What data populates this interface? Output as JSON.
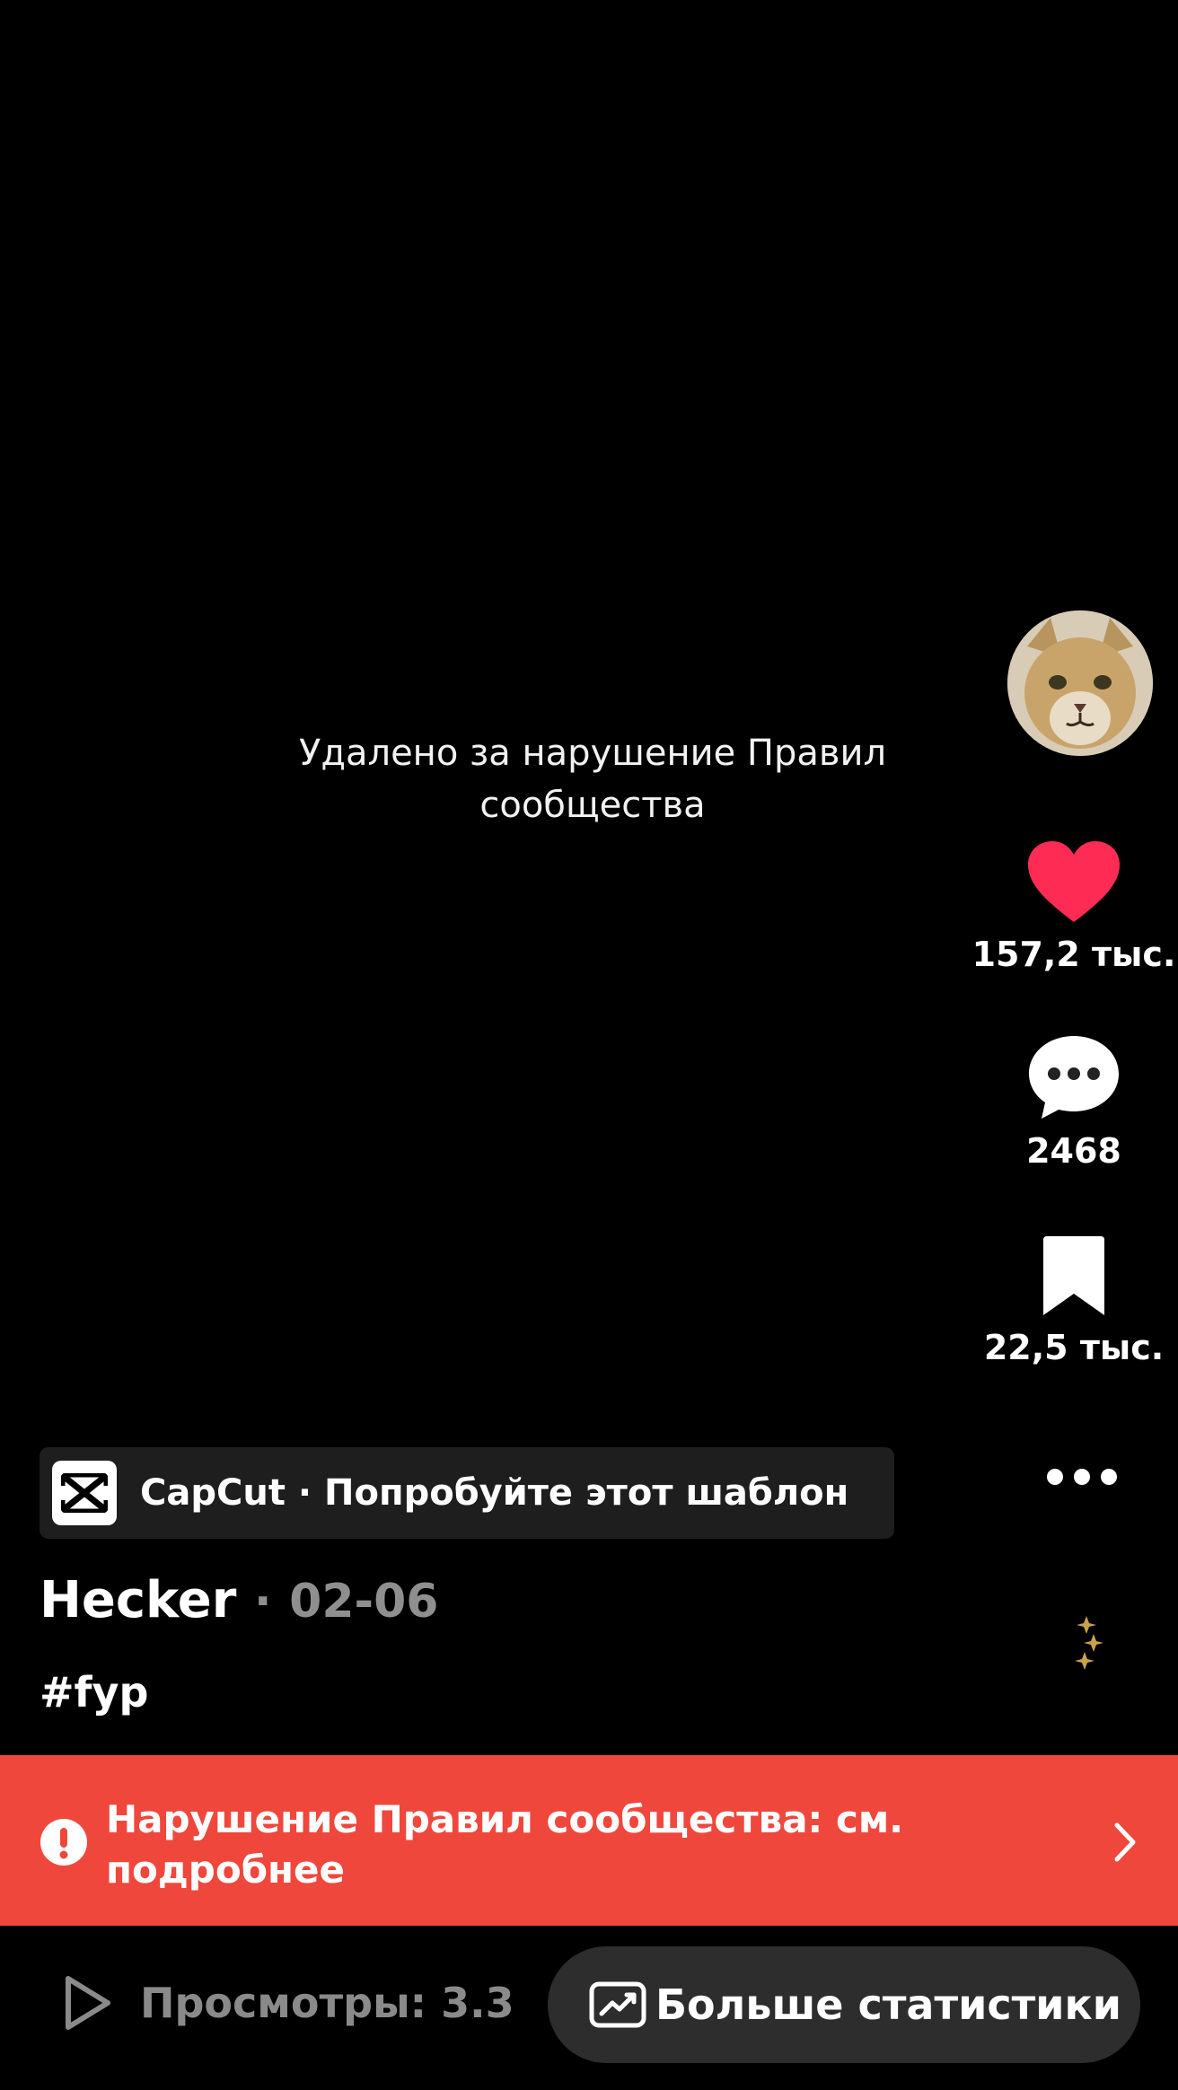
{
  "video": {
    "removed_message": "Удалено за нарушение Правил сообщества"
  },
  "rail": {
    "likes": "157,2 тыс.",
    "comments": "2468",
    "saves": "22,5 тыс."
  },
  "capcut": {
    "label": "CapCut · Попробуйте этот шаблон"
  },
  "post": {
    "author": "Hecker",
    "separator": "·",
    "date": "02-06",
    "hashtag": "#fyp"
  },
  "violation": {
    "text": "Нарушение Правил сообщества: см. подробнее"
  },
  "footer": {
    "views_label": "Просмотры: 3.3",
    "stats_button": "Больше статистики"
  },
  "colors": {
    "like": "#fe2c55",
    "violation_banner": "#f0473c",
    "sparkle": "#c9a24a"
  }
}
